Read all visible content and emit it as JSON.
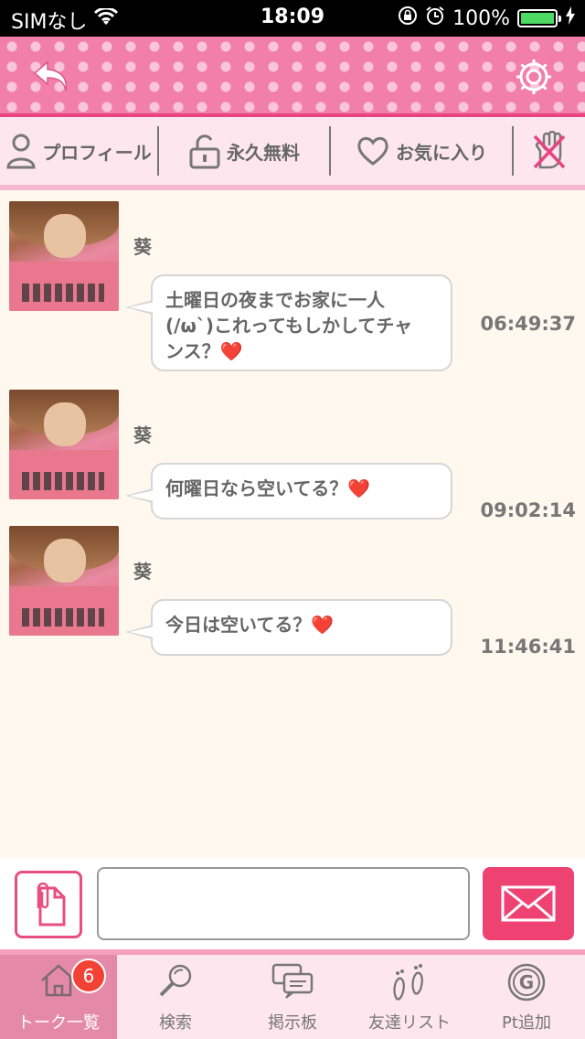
{
  "status_bar": {
    "carrier": "SIMなし",
    "time": "18:09",
    "battery_percent": "100%"
  },
  "header": {
    "back_icon": "undo-arrow-icon",
    "settings_icon": "gear-icon"
  },
  "top_nav": {
    "items": [
      {
        "label": "プロフィール",
        "icon": "person-icon"
      },
      {
        "label": "永久無料",
        "icon": "unlock-icon"
      },
      {
        "label": "お気に入り",
        "icon": "heart-icon"
      },
      {
        "label": "",
        "icon": "block-hand-icon"
      }
    ]
  },
  "messages": [
    {
      "sender": "葵",
      "text_line1": "土曜日の夜までお家に一人",
      "text_line2": "(/ω`)これってもしかしてチャ",
      "text_line3": "ンス？",
      "heart": "❤️",
      "time": "06:49:37"
    },
    {
      "sender": "葵",
      "text_line1": "何曜日なら空いてる？",
      "heart": "❤️",
      "time": "09:02:14"
    },
    {
      "sender": "葵",
      "text_line1": "今日は空いてる？",
      "heart": "❤️",
      "time": "11:46:41"
    }
  ],
  "composer": {
    "input_value": "",
    "attach_icon": "paperclip-document-icon",
    "send_icon": "envelope-icon"
  },
  "tabs": [
    {
      "label": "トーク一覧",
      "icon": "home-icon",
      "badge": "6",
      "active": true
    },
    {
      "label": "検索",
      "icon": "magnifier-icon"
    },
    {
      "label": "掲示板",
      "icon": "chat-board-icon"
    },
    {
      "label": "友達リスト",
      "icon": "footprints-icon"
    },
    {
      "label": "Pt追加",
      "icon": "g-coin-icon"
    }
  ],
  "colors": {
    "accent": "#e8457f",
    "send_button": "#ee4273",
    "badge": "#f24135"
  }
}
